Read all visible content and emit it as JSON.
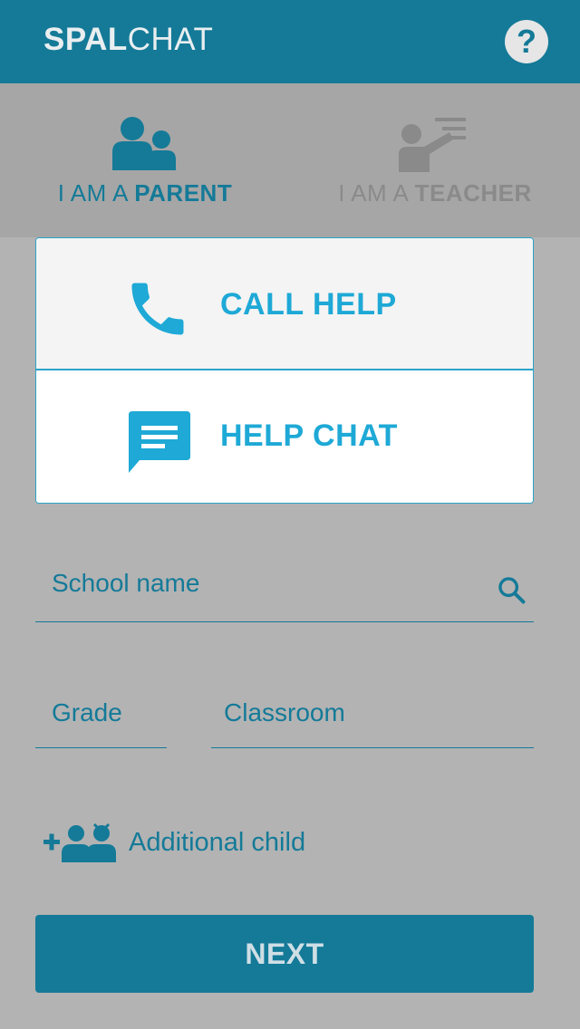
{
  "header": {
    "brand_bold": "SPAL",
    "brand_rest": "CHAT",
    "help_icon": "question-circle-icon",
    "help_glyph": "?"
  },
  "roles": {
    "parent": {
      "prefix": "I AM A ",
      "strong": "PARENT",
      "icon": "parent-icon",
      "active": true
    },
    "teacher": {
      "prefix": "I AM A ",
      "strong": "TEACHER",
      "icon": "teacher-icon",
      "active": false
    }
  },
  "help_popup": {
    "call_label": "CALL HELP",
    "call_icon": "phone-icon",
    "chat_label": "HELP CHAT",
    "chat_icon": "chat-icon"
  },
  "form": {
    "school_placeholder": "School name",
    "search_icon": "search-icon",
    "grade_placeholder": "Grade",
    "classroom_placeholder": "Classroom",
    "additional_child_label": "Additional child",
    "additional_child_icon": "add-children-icon",
    "next_label": "NEXT"
  },
  "colors": {
    "primary": "#147a98",
    "accent": "#1ea9d6",
    "overlay_bg": "#b3b3b3"
  }
}
